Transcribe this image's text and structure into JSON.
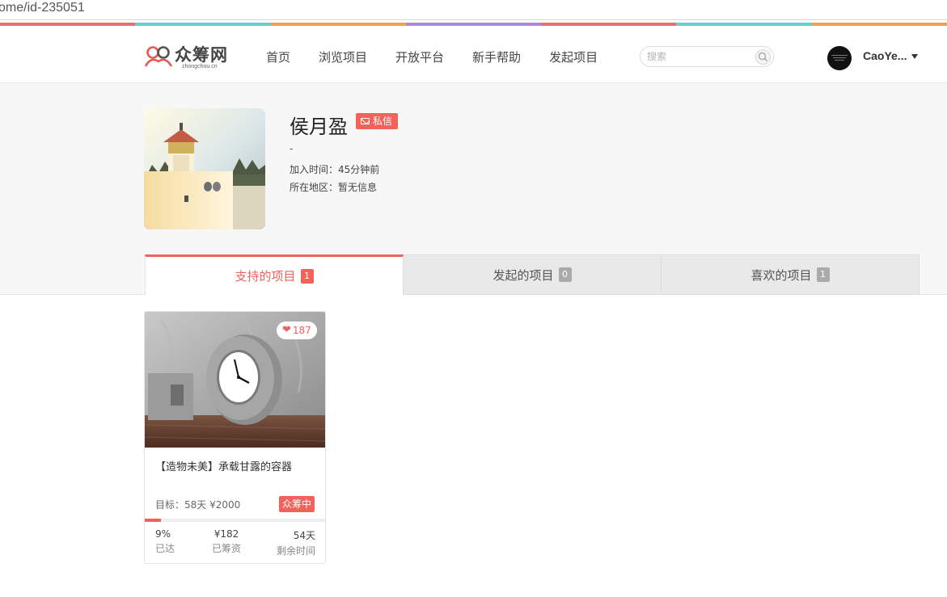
{
  "browser": {
    "url": "ome/id-235051"
  },
  "brand": {
    "name": "众筹网",
    "domain": "zhongchou.cn"
  },
  "nav": [
    "首页",
    "浏览项目",
    "开放平台",
    "新手帮助",
    "发起项目"
  ],
  "search": {
    "placeholder": "搜索"
  },
  "user": {
    "name": "CaoYe..."
  },
  "stripe_colors": [
    "#e96e6e",
    "#6ccfcf",
    "#f2a154",
    "#a98bd6",
    "#e96e6e",
    "#6ccfcf",
    "#f2a154"
  ],
  "profile": {
    "name": "侯月盈",
    "message_label": "私信",
    "dash": "-",
    "joined": "加入时间：45分钟前",
    "location": "所在地区：暂无信息"
  },
  "tabs": [
    {
      "label": "支持的项目",
      "count": "1"
    },
    {
      "label": "发起的项目",
      "count": "0"
    },
    {
      "label": "喜欢的项目",
      "count": "1"
    }
  ],
  "card": {
    "likes": "187",
    "title": "【造物未美】承载甘露的容器",
    "goal": "目标：58天 ¥2000",
    "status": "众筹中",
    "progress_percent": 9,
    "stats": [
      {
        "value": "9%",
        "label": "已达"
      },
      {
        "value": "¥182",
        "label": "已筹资"
      },
      {
        "value": "54天",
        "label": "剩余时间"
      }
    ]
  },
  "colors": {
    "accent": "#f2615a"
  }
}
